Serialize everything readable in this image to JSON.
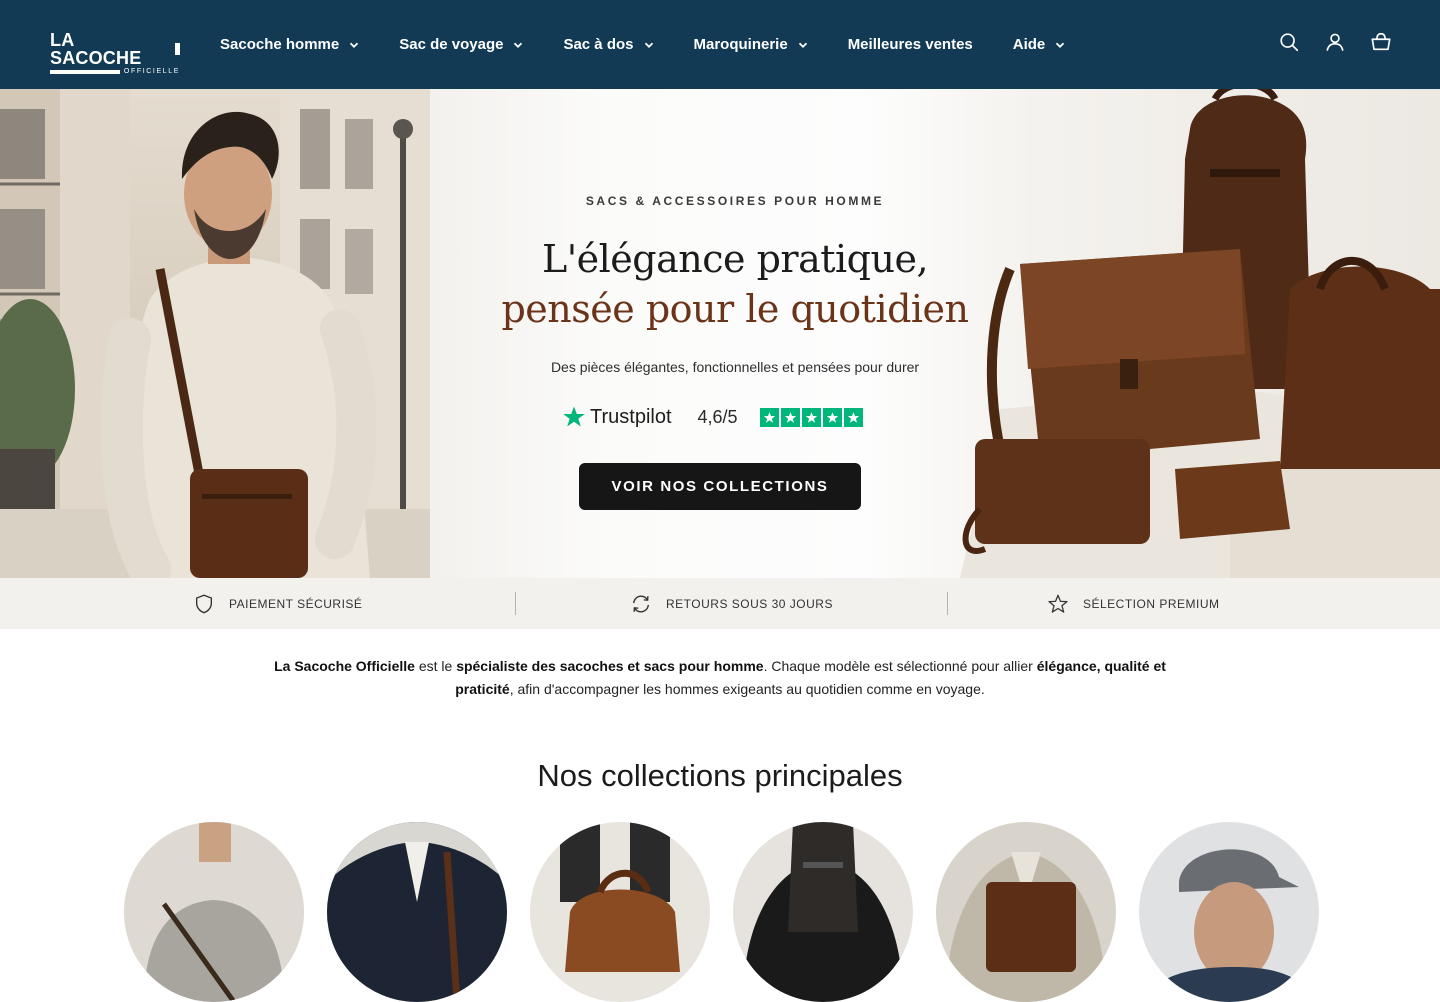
{
  "header": {
    "logo_main": "LA SACOCHE",
    "logo_sub": "OFFICIELLE",
    "nav": [
      {
        "label": "Sacoche homme",
        "dropdown": true
      },
      {
        "label": "Sac de voyage",
        "dropdown": true
      },
      {
        "label": "Sac à dos",
        "dropdown": true
      },
      {
        "label": "Maroquinerie",
        "dropdown": true
      },
      {
        "label": "Meilleures ventes",
        "dropdown": false
      },
      {
        "label": "Aide",
        "dropdown": true
      }
    ],
    "icons": [
      "search-icon",
      "account-icon",
      "cart-icon"
    ]
  },
  "hero": {
    "eyebrow": "SACS & ACCESSOIRES POUR HOMME",
    "title_line1": "L'élégance pratique,",
    "title_line2": "pensée pour le quotidien",
    "subtitle": "Des pièces élégantes, fonctionnelles et pensées pour durer",
    "trustpilot_name": "Trustpilot",
    "trustpilot_score": "4,6/5",
    "trustpilot_stars": 5,
    "cta_label": "VOIR NOS COLLECTIONS"
  },
  "features": [
    {
      "label": "PAIEMENT SÉCURISÉ",
      "icon": "shield-icon"
    },
    {
      "label": "RETOURS SOUS 30 JOURS",
      "icon": "refresh-icon"
    },
    {
      "label": "SÉLECTION PREMIUM",
      "icon": "star-icon"
    }
  ],
  "intro": {
    "brand": "La Sacoche Officielle",
    "t1": " est le ",
    "b1": "spécialiste des sacoches et sacs pour homme",
    "t2": ". Chaque modèle est sélectionné pour allier ",
    "b2": "élégance, qualité et praticité",
    "t3": ", afin d'accompagner les hommes exigeants au quotidien comme en voyage."
  },
  "collections": {
    "title": "Nos collections principales"
  },
  "colors": {
    "header_bg": "#123a54",
    "cta_bg": "#161616",
    "trustpilot_green": "#00b67a",
    "title_brown": "#6b3318"
  }
}
